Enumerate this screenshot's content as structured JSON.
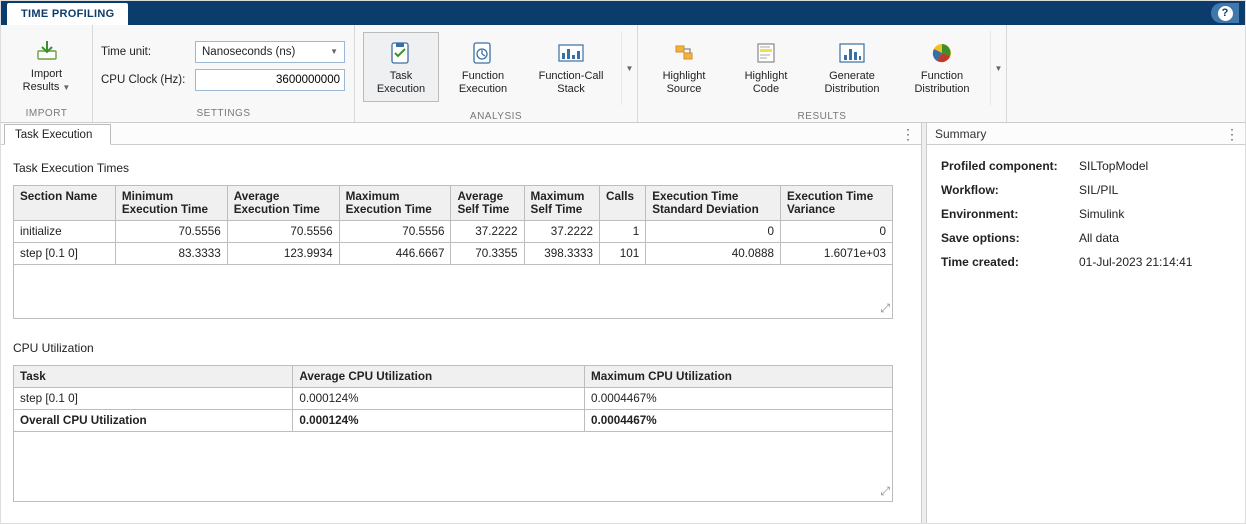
{
  "titleTab": "TIME PROFILING",
  "ribbon": {
    "import": {
      "label": "Import\nResults",
      "groupLabel": "IMPORT"
    },
    "settings": {
      "groupLabel": "SETTINGS",
      "timeUnitLabel": "Time unit:",
      "timeUnitValue": "Nanoseconds (ns)",
      "cpuClockLabel": "CPU Clock (Hz):",
      "cpuClockValue": "3600000000"
    },
    "analysis": {
      "groupLabel": "ANALYSIS",
      "taskExec": "Task\nExecution",
      "funcExec": "Function\nExecution",
      "funcCall": "Function-Call\nStack"
    },
    "results": {
      "groupLabel": "RESULTS",
      "hlSource": "Highlight\nSource",
      "hlCode": "Highlight\nCode",
      "genDist": "Generate\nDistribution",
      "funcDist": "Function\nDistribution"
    }
  },
  "docTab": "Task Execution",
  "sections": {
    "execTimesTitle": "Task Execution Times",
    "cpuUtilTitle": "CPU Utilization"
  },
  "execTable": {
    "headers": [
      "Section Name",
      "Minimum\nExecution Time",
      "Average\nExecution Time",
      "Maximum\nExecution Time",
      "Average\nSelf Time",
      "Maximum\nSelf Time",
      "Calls",
      "Execution Time\nStandard Deviation",
      "Execution Time\nVariance"
    ],
    "rows": [
      {
        "name": "initialize",
        "min": "70.5556",
        "avg": "70.5556",
        "max": "70.5556",
        "avgself": "37.2222",
        "maxself": "37.2222",
        "calls": "1",
        "std": "0",
        "var": "0"
      },
      {
        "name": "step [0.1 0]",
        "min": "83.3333",
        "avg": "123.9934",
        "max": "446.6667",
        "avgself": "70.3355",
        "maxself": "398.3333",
        "calls": "101",
        "std": "40.0888",
        "var": "1.6071e+03"
      }
    ]
  },
  "cpuTable": {
    "headers": [
      "Task",
      "Average CPU Utilization",
      "Maximum CPU Utilization"
    ],
    "rows": [
      {
        "task": "step [0.1 0]",
        "avg": "0.000124%",
        "max": "0.0004467%",
        "bold": false
      },
      {
        "task": "Overall CPU Utilization",
        "avg": "0.000124%",
        "max": "0.0004467%",
        "bold": true
      }
    ]
  },
  "summary": {
    "title": "Summary",
    "items": [
      {
        "k": "Profiled component:",
        "v": "SILTopModel"
      },
      {
        "k": "Workflow:",
        "v": "SIL/PIL"
      },
      {
        "k": "Environment:",
        "v": "Simulink"
      },
      {
        "k": "Save options:",
        "v": "All data"
      },
      {
        "k": "Time created:",
        "v": "01-Jul-2023 21:14:41"
      }
    ]
  }
}
